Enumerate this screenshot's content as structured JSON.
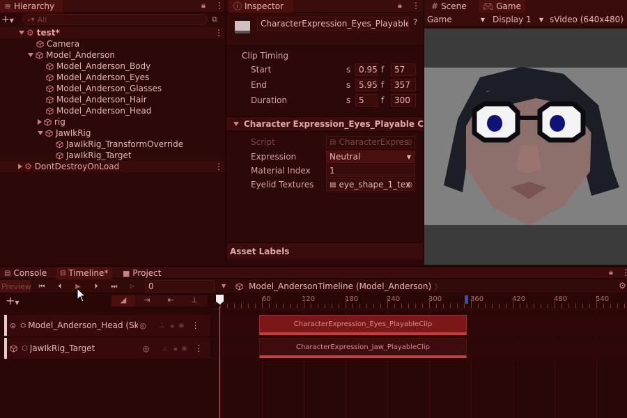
{
  "hierarchy": {
    "tab_label": "Hierarchy",
    "search_placeholder": "All",
    "items": [
      {
        "label": "test*"
      },
      {
        "label": "Camera"
      },
      {
        "label": "Model_Anderson"
      },
      {
        "label": "Model_Anderson_Body"
      },
      {
        "label": "Model_Anderson_Eyes"
      },
      {
        "label": "Model_Anderson_Glasses"
      },
      {
        "label": "Model_Anderson_Hair"
      },
      {
        "label": "Model_Anderson_Head"
      },
      {
        "label": "rig"
      },
      {
        "label": "JawIkRig"
      },
      {
        "label": "JawIkRig_TransformOverride"
      },
      {
        "label": "JawIkRig_Target"
      },
      {
        "label": "DontDestroyOnLoad"
      }
    ]
  },
  "inspector": {
    "tab_label": "Inspector",
    "object_name": "CharacterExpression_Eyes_PlayableC",
    "clip_timing": {
      "header": "Clip Timing",
      "rows": [
        {
          "label": "Start",
          "s_label": "s",
          "s_value": "0.95",
          "f_label": "f",
          "f_value": "57"
        },
        {
          "label": "End",
          "s_label": "s",
          "s_value": "5.95",
          "f_label": "f",
          "f_value": "357"
        },
        {
          "label": "Duration",
          "s_label": "s",
          "s_value": "5",
          "f_label": "f",
          "f_value": "300"
        }
      ]
    },
    "component": {
      "title": "Character Expression_Eyes_Playable Clip",
      "script_label": "Script",
      "script_value": "CharacterExpres",
      "expression_label": "Expression",
      "expression_value": "Neutral",
      "material_index_label": "Material Index",
      "material_index_value": "1",
      "eyelid_label": "Eyelid Textures",
      "eyelid_value": "eye_shape_1_tex"
    },
    "asset_labels": "Asset Labels"
  },
  "game": {
    "scene_tab": "Scene",
    "game_tab": "Game",
    "game_dropdown": "Game",
    "display_dropdown": "Display 1",
    "resolution": "sVideo (640x480)"
  },
  "bottom_tabs": {
    "console": "Console",
    "timeline": "Timeline*",
    "project": "Project"
  },
  "timeline": {
    "preview_label": "Preview",
    "frame_value": "0",
    "breadcrumb": "Model_AndersonTimeline (Model_Anderson)",
    "ruler_labels": [
      "60",
      "120",
      "180",
      "240",
      "300",
      "360",
      "420",
      "480",
      "540"
    ],
    "tracks": [
      {
        "label": "Model_Anderson_Head (Ski",
        "clip": "CharacterExpression_Eyes_PlayableClip"
      },
      {
        "label": "JawIkRig_Target",
        "clip": "CharacterExpression_Jaw_PlayableClip"
      }
    ]
  }
}
